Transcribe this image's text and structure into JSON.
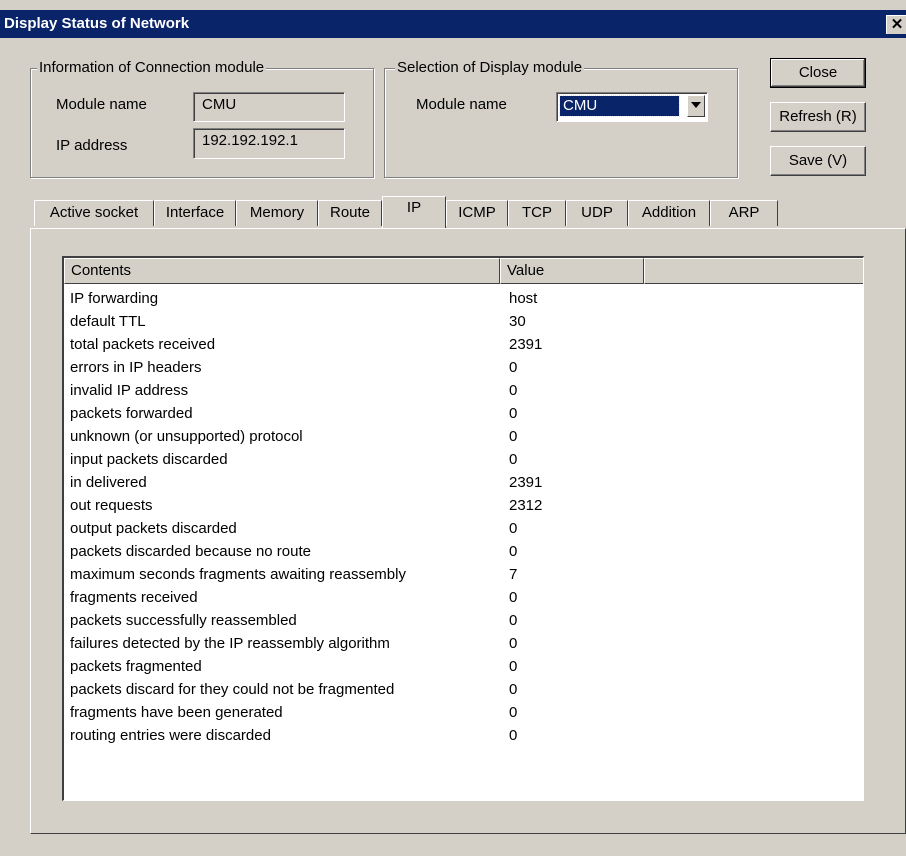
{
  "window": {
    "title": "Display Status of Network",
    "close_glyph": "✕"
  },
  "connection_group": {
    "legend": "Information of Connection module",
    "module_name_label": "Module name",
    "module_name_value": "CMU",
    "ip_label": "IP address",
    "ip_value": "192.192.192.1"
  },
  "display_group": {
    "legend": "Selection of Display module",
    "module_name_label": "Module name",
    "selected_module": "CMU"
  },
  "buttons": {
    "close": "Close",
    "refresh": "Refresh (R)",
    "save": "Save (V)"
  },
  "tabs": [
    {
      "label": "Active socket",
      "active": false
    },
    {
      "label": "Interface",
      "active": false
    },
    {
      "label": "Memory",
      "active": false
    },
    {
      "label": "Route",
      "active": false
    },
    {
      "label": "IP",
      "active": true
    },
    {
      "label": "ICMP",
      "active": false
    },
    {
      "label": "TCP",
      "active": false
    },
    {
      "label": "UDP",
      "active": false
    },
    {
      "label": "Addition",
      "active": false
    },
    {
      "label": "ARP",
      "active": false
    }
  ],
  "table": {
    "columns": [
      "Contents",
      "Value",
      ""
    ],
    "rows": [
      {
        "contents": "IP forwarding",
        "value": "host"
      },
      {
        "contents": "default TTL",
        "value": "30"
      },
      {
        "contents": "total packets received",
        "value": "2391"
      },
      {
        "contents": "errors in IP headers",
        "value": "0"
      },
      {
        "contents": "invalid IP address",
        "value": "0"
      },
      {
        "contents": "packets forwarded",
        "value": "0"
      },
      {
        "contents": "unknown (or unsupported) protocol",
        "value": "0"
      },
      {
        "contents": "input packets discarded",
        "value": "0"
      },
      {
        "contents": "in delivered",
        "value": "2391"
      },
      {
        "contents": "out requests",
        "value": "2312"
      },
      {
        "contents": "output packets discarded",
        "value": "0"
      },
      {
        "contents": "packets discarded because no route",
        "value": "0"
      },
      {
        "contents": "maximum seconds fragments awaiting reassembly",
        "value": "7"
      },
      {
        "contents": "fragments received",
        "value": "0"
      },
      {
        "contents": "packets successfully reassembled",
        "value": "0"
      },
      {
        "contents": "failures detected by the IP reassembly algorithm",
        "value": "0"
      },
      {
        "contents": "packets fragmented",
        "value": "0"
      },
      {
        "contents": "packets discard for they could not be fragmented",
        "value": "0"
      },
      {
        "contents": "fragments have been generated",
        "value": "0"
      },
      {
        "contents": "routing entries were discarded",
        "value": "0"
      }
    ]
  },
  "colors": {
    "titlebar": "#0a246a",
    "face": "#d4d0c8",
    "selection": "#0a246a"
  }
}
